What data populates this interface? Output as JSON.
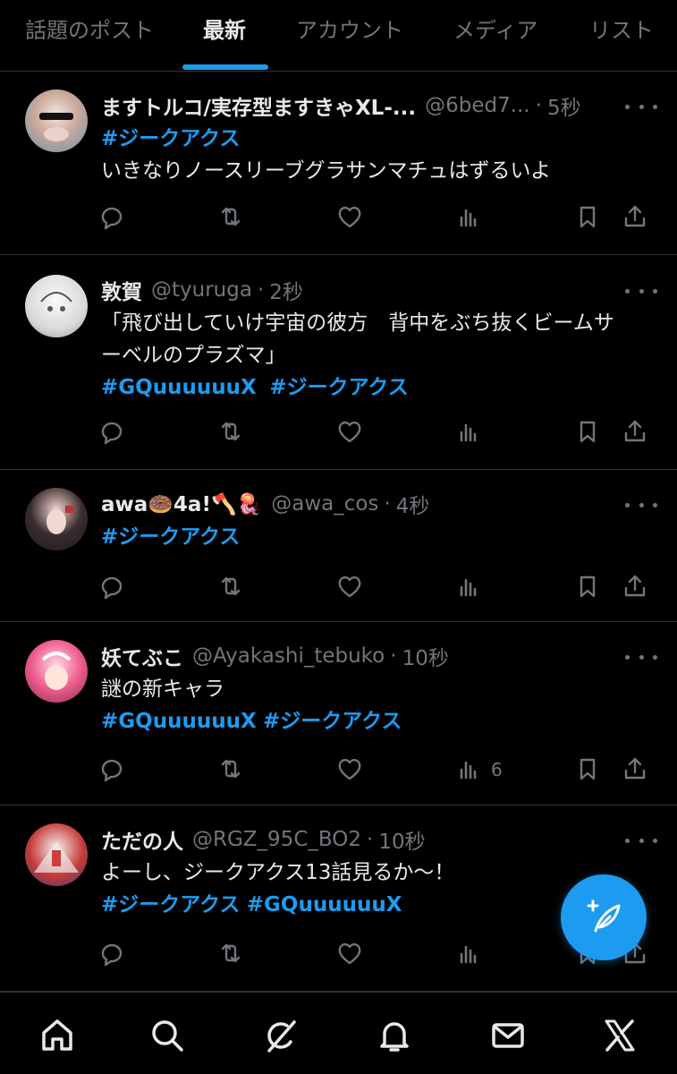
{
  "tabs": [
    "話題のポスト",
    "最新",
    "アカウント",
    "メディア",
    "リスト"
  ],
  "posts": [
    {
      "name": "ますトルコ/実存型ますきゃXL-...",
      "handle": "@6bed7...",
      "time": "5秒",
      "lines": [
        [
          {
            "t": "#ジークアクス",
            "h": true
          }
        ],
        [
          {
            "t": "いきなりノースリーブグラサンマチュはずるいよ",
            "h": false
          }
        ]
      ],
      "views": ""
    },
    {
      "name": "敦賀",
      "handle": "@tyuruga",
      "time": "2秒",
      "lines": [
        [
          {
            "t": "「飛び出していけ宇宙の彼方　背中をぶち抜くビームサ",
            "h": false
          }
        ],
        [
          {
            "t": "ーベルのプラズマ」",
            "h": false
          }
        ],
        [
          {
            "t": "#GQuuuuuuX",
            "h": true
          },
          {
            "t": "  ",
            "h": false
          },
          {
            "t": "#ジークアクス",
            "h": true
          }
        ]
      ],
      "views": ""
    },
    {
      "name": "awa🍩4a!🪓🪼",
      "handle": "@awa_cos",
      "time": "4秒",
      "lines": [
        [
          {
            "t": "#ジークアクス",
            "h": true
          }
        ]
      ],
      "views": ""
    },
    {
      "name": "妖てぶこ",
      "handle": "@Ayakashi_tebuko",
      "time": "10秒",
      "lines": [
        [
          {
            "t": "謎の新キャラ",
            "h": false
          }
        ],
        [
          {
            "t": "#GQuuuuuuX",
            "h": true
          },
          {
            "t": " ",
            "h": false
          },
          {
            "t": "#ジークアクス",
            "h": true
          }
        ]
      ],
      "views": "6"
    },
    {
      "name": "ただの人",
      "handle": "@RGZ_95C_BO2",
      "time": "10秒",
      "lines": [
        [
          {
            "t": "よーし、ジークアクス13話見るか〜！",
            "h": false
          }
        ],
        [
          {
            "t": "#ジークアクス",
            "h": true
          },
          {
            "t": " ",
            "h": false
          },
          {
            "t": "#GQuuuuuuX",
            "h": true
          }
        ]
      ],
      "views": ""
    }
  ],
  "fab_icon": "compose-post-icon",
  "bottom_nav": [
    "home-icon",
    "search-icon",
    "grok-icon",
    "notifications-icon",
    "messages-icon",
    "x-logo-icon"
  ],
  "colors": {
    "accent": "#1d9bf0",
    "muted": "#71767b",
    "text": "#e7e9ea",
    "background": "#000000",
    "divider": "#2f3336"
  }
}
